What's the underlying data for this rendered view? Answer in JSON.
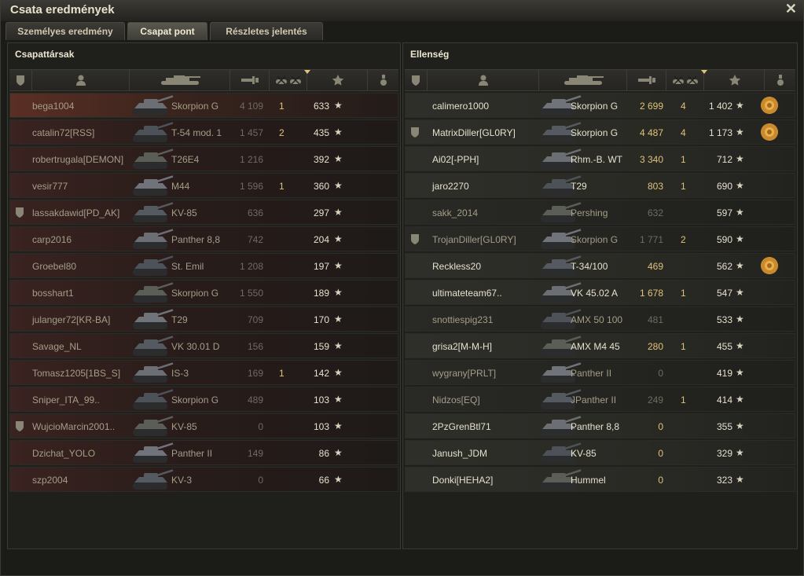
{
  "window": {
    "title": "Csata eredmények"
  },
  "tabs": [
    {
      "label": "Személyes eredmény",
      "active": false
    },
    {
      "label": "Csapat pont",
      "active": true
    },
    {
      "label": "Részletes jelentés",
      "active": false
    }
  ],
  "allies": {
    "title": "Csapattársak",
    "rows": [
      {
        "player": "bega1004",
        "tank": "Skorpion G",
        "damage": "4 109",
        "kills": "1",
        "score": "633",
        "clan_badge": false,
        "self": true
      },
      {
        "player": "catalin72[RSS]",
        "tank": "T-54 mod. 1",
        "damage": "1 457",
        "kills": "2",
        "score": "435",
        "clan_badge": false
      },
      {
        "player": "robertrugala[DEMON]",
        "tank": "T26E4",
        "damage": "1 216",
        "kills": "",
        "score": "392",
        "clan_badge": false
      },
      {
        "player": "vesir777",
        "tank": "M44",
        "damage": "1 596",
        "kills": "1",
        "score": "360",
        "clan_badge": false
      },
      {
        "player": "lassakdawid[PD_AK]",
        "tank": "KV-85",
        "damage": "636",
        "kills": "",
        "score": "297",
        "clan_badge": true
      },
      {
        "player": "carp2016",
        "tank": "Panther 8,8",
        "damage": "742",
        "kills": "",
        "score": "204",
        "clan_badge": false
      },
      {
        "player": "Groebel80",
        "tank": "St. Emil",
        "damage": "1 208",
        "kills": "",
        "score": "197",
        "clan_badge": false
      },
      {
        "player": "bosshart1",
        "tank": "Skorpion G",
        "damage": "1 550",
        "kills": "",
        "score": "189",
        "clan_badge": false
      },
      {
        "player": "julanger72[KR-BA]",
        "tank": "T29",
        "damage": "709",
        "kills": "",
        "score": "170",
        "clan_badge": false
      },
      {
        "player": "Savage_NL",
        "tank": "VK 30.01 D",
        "damage": "156",
        "kills": "",
        "score": "159",
        "clan_badge": false
      },
      {
        "player": "Tomasz1205[1BS_S]",
        "tank": "IS-3",
        "damage": "169",
        "kills": "1",
        "score": "142",
        "clan_badge": false
      },
      {
        "player": "Sniper_ITA_99..",
        "tank": "Skorpion G",
        "damage": "489",
        "kills": "",
        "score": "103",
        "clan_badge": false
      },
      {
        "player": "WujcioMarcin2001..",
        "tank": "KV-85",
        "damage": "0",
        "kills": "",
        "score": "103",
        "clan_badge": true
      },
      {
        "player": "Dzichat_YOLO",
        "tank": "Panther II",
        "damage": "149",
        "kills": "",
        "score": "86",
        "clan_badge": false
      },
      {
        "player": "szp2004",
        "tank": "KV-3",
        "damage": "0",
        "kills": "",
        "score": "66",
        "clan_badge": false
      }
    ]
  },
  "enemies": {
    "title": "Ellenség",
    "rows": [
      {
        "player": "calimero1000",
        "tank": "Skorpion G",
        "damage": "2 699",
        "kills": "4",
        "score": "1 402",
        "clan_badge": false,
        "alive": true,
        "medal": true
      },
      {
        "player": "MatrixDiller[GL0RY]",
        "tank": "Skorpion G",
        "damage": "4 487",
        "kills": "4",
        "score": "1 173",
        "clan_badge": true,
        "alive": true,
        "medal": true
      },
      {
        "player": "Ai02[-PPH]",
        "tank": "Rhm.-B. WT",
        "damage": "3 340",
        "kills": "1",
        "score": "712",
        "clan_badge": false,
        "alive": true
      },
      {
        "player": "jaro2270",
        "tank": "T29",
        "damage": "803",
        "kills": "1",
        "score": "690",
        "clan_badge": false,
        "alive": true
      },
      {
        "player": "sakk_2014",
        "tank": "Pershing",
        "damage": "632",
        "kills": "",
        "score": "597",
        "clan_badge": false,
        "alive": false
      },
      {
        "player": "TrojanDiller[GL0RY]",
        "tank": "Skorpion G",
        "damage": "1 771",
        "kills": "2",
        "score": "590",
        "clan_badge": true,
        "alive": false
      },
      {
        "player": "Reckless20",
        "tank": "T-34/100",
        "damage": "469",
        "kills": "",
        "score": "562",
        "clan_badge": false,
        "alive": true,
        "medal": true
      },
      {
        "player": "ultimateteam67..",
        "tank": "VK 45.02 A",
        "damage": "1 678",
        "kills": "1",
        "score": "547",
        "clan_badge": false,
        "alive": true
      },
      {
        "player": "snottiespig231",
        "tank": "AMX 50 100",
        "damage": "481",
        "kills": "",
        "score": "533",
        "clan_badge": false,
        "alive": false
      },
      {
        "player": "grisa2[M-M-H]",
        "tank": "AMX M4 45",
        "damage": "280",
        "kills": "1",
        "score": "455",
        "clan_badge": false,
        "alive": true
      },
      {
        "player": "wygrany[PRLT]",
        "tank": "Panther II",
        "damage": "0",
        "kills": "",
        "score": "419",
        "clan_badge": false,
        "alive": false
      },
      {
        "player": "Nidzos[EQ]",
        "tank": "JPanther II",
        "damage": "249",
        "kills": "1",
        "score": "414",
        "clan_badge": false,
        "alive": false
      },
      {
        "player": "2PzGrenBtl71",
        "tank": "Panther 8,8",
        "damage": "0",
        "kills": "",
        "score": "355",
        "clan_badge": false,
        "alive": true
      },
      {
        "player": "Janush_JDM",
        "tank": "KV-85",
        "damage": "0",
        "kills": "",
        "score": "329",
        "clan_badge": false,
        "alive": true
      },
      {
        "player": "Donki[HEHA2]",
        "tank": "Hummel",
        "damage": "0",
        "kills": "",
        "score": "323",
        "clan_badge": false,
        "alive": true
      }
    ]
  },
  "columns": [
    {
      "icon": "clan-badge-icon"
    },
    {
      "icon": "player-icon"
    },
    {
      "icon": "tank-icon"
    },
    {
      "icon": "damage-icon"
    },
    {
      "icon": "kills-icon"
    },
    {
      "icon": "score-star-icon",
      "sorted": true
    },
    {
      "icon": "medal-icon"
    }
  ],
  "colors": {
    "accent_gold": "#e0c27a",
    "ally_row": "#3a2320",
    "enemy_row": "#2a2a25"
  }
}
